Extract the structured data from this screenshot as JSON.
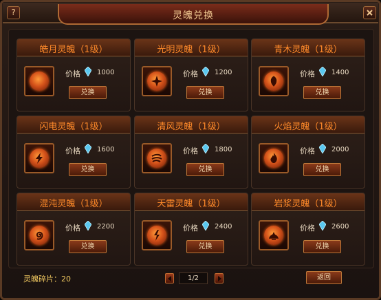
{
  "window": {
    "title": "灵魄兑换",
    "help_label": "?",
    "close_label": "X"
  },
  "price_label": "价格",
  "exchange_label": "兑换",
  "cards": [
    {
      "name": "皓月灵魄（1级）",
      "price": "1000",
      "icon": "crescent-moon-icon"
    },
    {
      "name": "光明灵魄（1级）",
      "price": "1200",
      "icon": "sparkle-icon"
    },
    {
      "name": "青木灵魄（1级）",
      "price": "1400",
      "icon": "leaf-icon"
    },
    {
      "name": "闪电灵魄（1级）",
      "price": "1600",
      "icon": "lightning-icon"
    },
    {
      "name": "清风灵魄（1级）",
      "price": "1800",
      "icon": "wind-icon"
    },
    {
      "name": "火焰灵魄（1级）",
      "price": "2000",
      "icon": "flame-icon"
    },
    {
      "name": "混沌灵魄（1级）",
      "price": "2200",
      "icon": "swirl-icon"
    },
    {
      "name": "天雷灵魄（1级）",
      "price": "2400",
      "icon": "thunder-icon"
    },
    {
      "name": "岩浆灵魄（1级）",
      "price": "2600",
      "icon": "magma-icon"
    }
  ],
  "footer": {
    "fragments_label": "灵魄碎片：",
    "fragments_value": "20",
    "page_indicator": "1/2",
    "back_label": "返回"
  },
  "colors": {
    "title_accent": "#ff8a2a",
    "gem": "#5ac8f0",
    "footer_text": "#f0c860"
  }
}
